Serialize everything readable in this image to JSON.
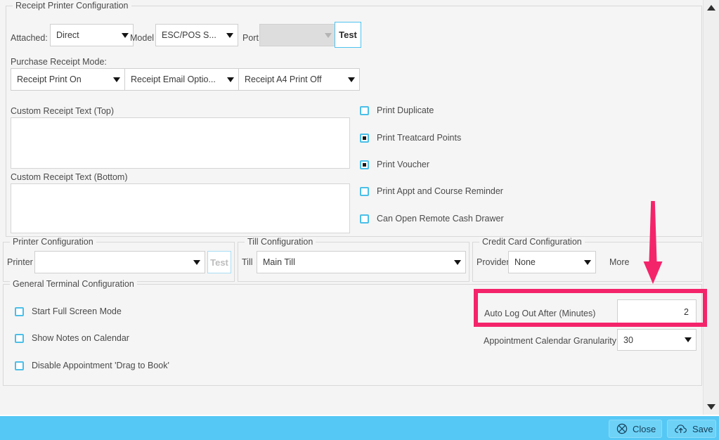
{
  "receipt_printer": {
    "legend": "Receipt Printer Configuration",
    "attached_label": "Attached:",
    "attached_value": "Direct",
    "model_label": "Model",
    "model_value": "ESC/POS S...",
    "port_label": "Port",
    "port_value": "",
    "test_label": "Test",
    "purchase_mode_label": "Purchase Receipt Mode:",
    "mode_print_value": "Receipt Print On",
    "mode_email_value": "Receipt Email Optio...",
    "mode_a4_value": "Receipt A4 Print Off",
    "custom_top_label": "Custom Receipt Text (Top)",
    "custom_top_value": "",
    "custom_bottom_label": "Custom Receipt Text (Bottom)",
    "custom_bottom_value": "",
    "options": [
      {
        "label": "Print Duplicate",
        "checked": false
      },
      {
        "label": "Print Treatcard Points",
        "checked": true
      },
      {
        "label": "Print Voucher",
        "checked": true
      },
      {
        "label": "Print Appt and Course Reminder",
        "checked": false
      },
      {
        "label": "Can Open Remote Cash Drawer",
        "checked": false
      }
    ]
  },
  "printer_config": {
    "legend": "Printer Configuration",
    "printer_label": "Printer",
    "printer_value": "",
    "test_label": "Test"
  },
  "till_config": {
    "legend": "Till Configuration",
    "till_label": "Till",
    "till_value": "Main Till"
  },
  "credit_card_config": {
    "legend": "Credit Card Configuration",
    "provider_label": "Provider",
    "provider_value": "None",
    "more_label": "More"
  },
  "general_terminal": {
    "legend": "General Terminal Configuration",
    "options": [
      {
        "label": "Start Full Screen Mode",
        "checked": false
      },
      {
        "label": "Show Notes on Calendar",
        "checked": false
      },
      {
        "label": "Disable Appointment 'Drag to Book'",
        "checked": false
      }
    ],
    "auto_logout_label": "Auto Log Out After (Minutes)",
    "auto_logout_value": "2",
    "granularity_label": "Appointment Calendar Granularity",
    "granularity_value": "30"
  },
  "bottom_bar": {
    "close_label": "Close",
    "save_label": "Save"
  },
  "annotations": {
    "highlight_color": "#f4246b",
    "arrow_color": "#f4246b"
  },
  "icons": {
    "close": "close-circle-icon",
    "save": "cloud-upload-icon",
    "scroll_up": "triangle-up-icon",
    "scroll_down": "triangle-down-icon"
  }
}
